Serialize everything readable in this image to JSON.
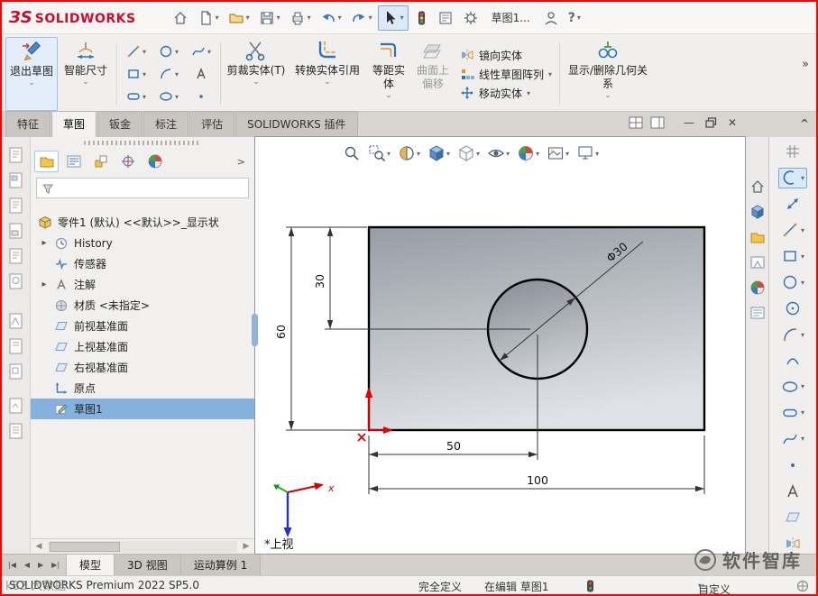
{
  "glyphs": {
    "dropdown": "▾",
    "small_down": "⌄",
    "overflow": "»",
    "collapse": "^",
    "expander": "▸",
    "close": "✕",
    "minimize": "—",
    "help": "?",
    "left_arrow": "◀",
    "right_arrow": "▶",
    "first_arrow": "|◀",
    "last_arrow": "▶|",
    "chevron_right": ">"
  },
  "titlebar": {
    "logo_glyph": "ЗS",
    "logo_text": "SOLIDWORKS",
    "doc_name": "草图1..."
  },
  "ribbon": {
    "exit_sketch": "退出草图",
    "smart_dimension": "智能尺寸",
    "trim_entities": "剪裁实体(T)",
    "convert_entities": "转换实体引用",
    "offset_entities": "等距实体",
    "surface_offset": "曲面上偏移",
    "mirror_entities": "镜向实体",
    "linear_pattern": "线性草图阵列",
    "move_entities": "移动实体",
    "display_relations": "显示/删除几何关系"
  },
  "command_tabs": {
    "features": "特征",
    "sketch": "草图",
    "sheet_metal": "钣金",
    "markup": "标注",
    "evaluate": "评估",
    "addins": "SOLIDWORKS 插件"
  },
  "feature_tree": {
    "root": "零件1 (默认) <<默认>>_显示状",
    "items": [
      {
        "label": "History"
      },
      {
        "label": "传感器"
      },
      {
        "label": "注解"
      },
      {
        "label": "材质 <未指定>"
      },
      {
        "label": "前视基准面"
      },
      {
        "label": "上视基准面"
      },
      {
        "label": "右视基准面"
      },
      {
        "label": "原点"
      },
      {
        "label": "草图1"
      }
    ]
  },
  "sketch_view": {
    "dim_height": "60",
    "dim_offset_top": "30",
    "dim_diameter": "Φ30",
    "dim_center_x": "50",
    "dim_width": "100",
    "view_label": "*上视",
    "axis_x_label": "x"
  },
  "bottom_tabs": {
    "model": "模型",
    "views_3d": "3D 视图",
    "motion_study": "运动算例 1"
  },
  "statusbar": {
    "product": "SOLIDWORKS Premium 2022 SP5.0",
    "define_status": "完全定义",
    "editing_status": "在编辑 草图1",
    "units": "自定义"
  },
  "watermarks": {
    "brand": "软件智库",
    "corner": "k82 大数据"
  }
}
